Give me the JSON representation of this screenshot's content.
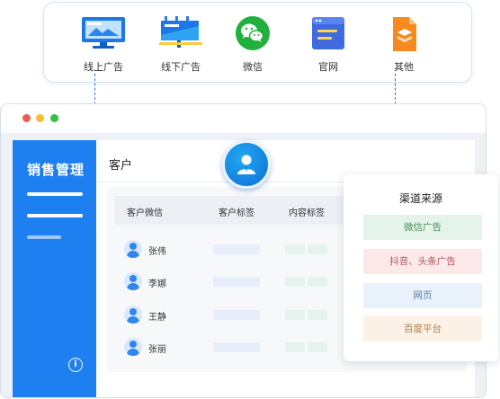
{
  "channels": [
    {
      "label": "线上广告",
      "icon": "monitor-icon"
    },
    {
      "label": "线下广告",
      "icon": "billboard-icon"
    },
    {
      "label": "微信",
      "icon": "wechat-icon"
    },
    {
      "label": "官网",
      "icon": "website-icon"
    },
    {
      "label": "其他",
      "icon": "layers-icon"
    }
  ],
  "sidebar": {
    "title": "销售管理",
    "info_glyph": "i"
  },
  "page": {
    "title": "客户"
  },
  "table": {
    "headers": [
      "客户微信",
      "客户标签",
      "内容标签"
    ],
    "rows": [
      {
        "name": "张伟"
      },
      {
        "name": "李娜"
      },
      {
        "name": "王静"
      },
      {
        "name": "张丽"
      }
    ]
  },
  "source_panel": {
    "title": "渠道来源",
    "items": [
      {
        "label": "微信广告",
        "bg": "#e4f4ea",
        "fg": "#4a8c5c"
      },
      {
        "label": "抖音、头条广告",
        "bg": "#fbe9ea",
        "fg": "#b3555c"
      },
      {
        "label": "网页",
        "bg": "#e9f2fb",
        "fg": "#4f7fb0"
      },
      {
        "label": "百度平台",
        "bg": "#fcf1e6",
        "fg": "#b07a45"
      }
    ]
  },
  "colors": {
    "accent": "#1e7ff0",
    "window_dots": [
      "#f25a52",
      "#f5bd2f",
      "#35c04a"
    ]
  }
}
